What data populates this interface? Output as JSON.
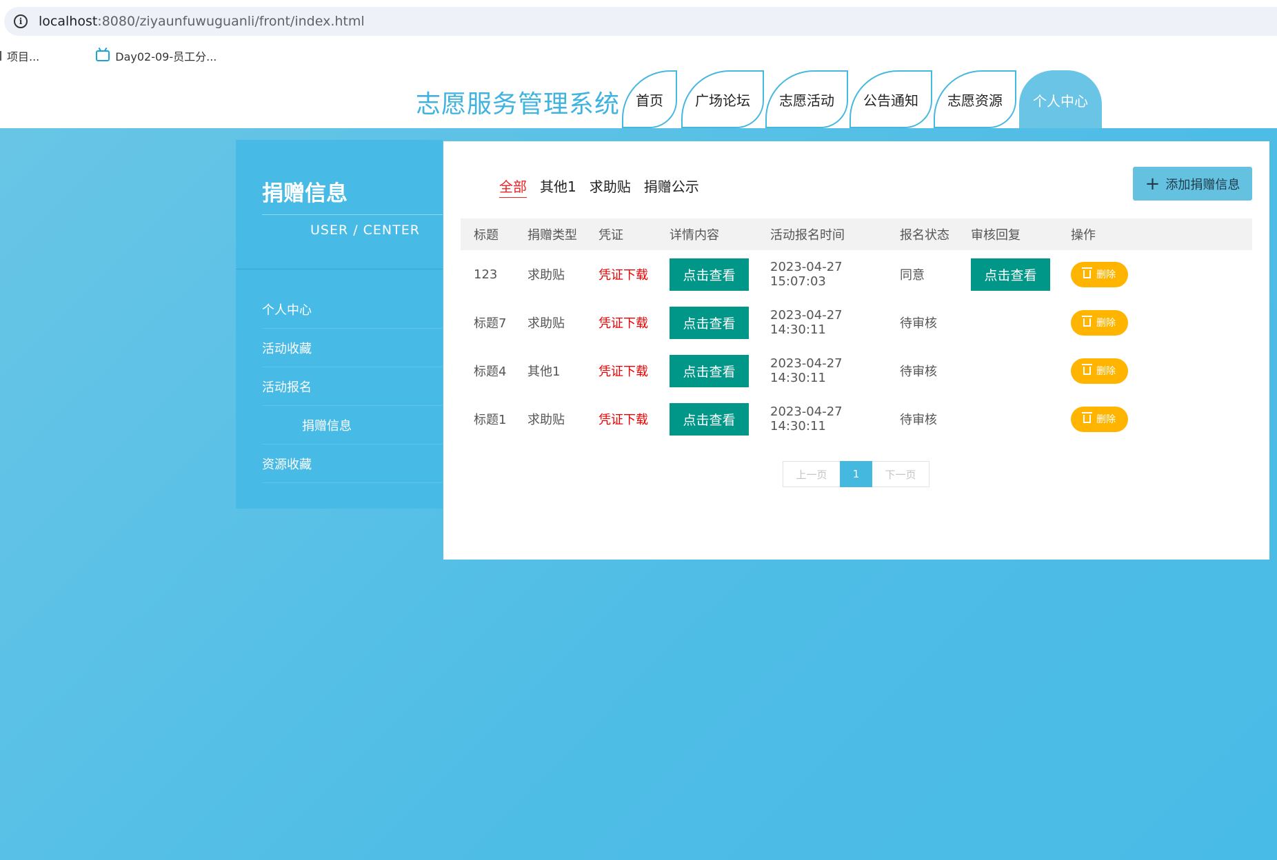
{
  "browser": {
    "url_host": "localhost",
    "url_path": ":8080/ziyaunfuwuguanli/front/index.html",
    "bookmarks": [
      {
        "label": "项目..."
      },
      {
        "label": "Day02-09-员工分..."
      }
    ]
  },
  "header": {
    "site_title": "志愿服务管理系统",
    "nav": [
      {
        "label": "首页"
      },
      {
        "label": "广场论坛"
      },
      {
        "label": "志愿活动"
      },
      {
        "label": "公告通知"
      },
      {
        "label": "志愿资源"
      },
      {
        "label": "个人中心"
      }
    ]
  },
  "sidebar": {
    "title": "捐赠信息",
    "subtitle": "USER / CENTER",
    "items": [
      {
        "label": "个人中心"
      },
      {
        "label": "活动收藏"
      },
      {
        "label": "活动报名"
      },
      {
        "label": "捐赠信息"
      },
      {
        "label": "资源收藏"
      }
    ]
  },
  "main": {
    "filters": [
      {
        "label": "全部"
      },
      {
        "label": "其他1"
      },
      {
        "label": "求助贴"
      },
      {
        "label": "捐赠公示"
      }
    ],
    "add_button": "添加捐赠信息",
    "table": {
      "headers": [
        "标题",
        "捐赠类型",
        "凭证",
        "详情内容",
        "活动报名时间",
        "报名状态",
        "审核回复",
        "操作"
      ],
      "rows": [
        {
          "title": "123",
          "type": "求助贴",
          "proof": "凭证下载",
          "detail": "点击查看",
          "time": "2023-04-27 15:07:03",
          "status": "同意",
          "reply": "点击查看",
          "action": "删除"
        },
        {
          "title": "标题7",
          "type": "求助贴",
          "proof": "凭证下载",
          "detail": "点击查看",
          "time": "2023-04-27 14:30:11",
          "status": "待审核",
          "reply": "",
          "action": "删除"
        },
        {
          "title": "标题4",
          "type": "其他1",
          "proof": "凭证下载",
          "detail": "点击查看",
          "time": "2023-04-27 14:30:11",
          "status": "待审核",
          "reply": "",
          "action": "删除"
        },
        {
          "title": "标题1",
          "type": "求助贴",
          "proof": "凭证下载",
          "detail": "点击查看",
          "time": "2023-04-27 14:30:11",
          "status": "待审核",
          "reply": "",
          "action": "删除"
        }
      ]
    },
    "pager": {
      "prev": "上一页",
      "current": "1",
      "next": "下一页"
    }
  },
  "colors": {
    "accent": "#45b8df",
    "teal_button": "#009789",
    "delete_button": "#ffb400",
    "proof_link": "#ee0000"
  }
}
